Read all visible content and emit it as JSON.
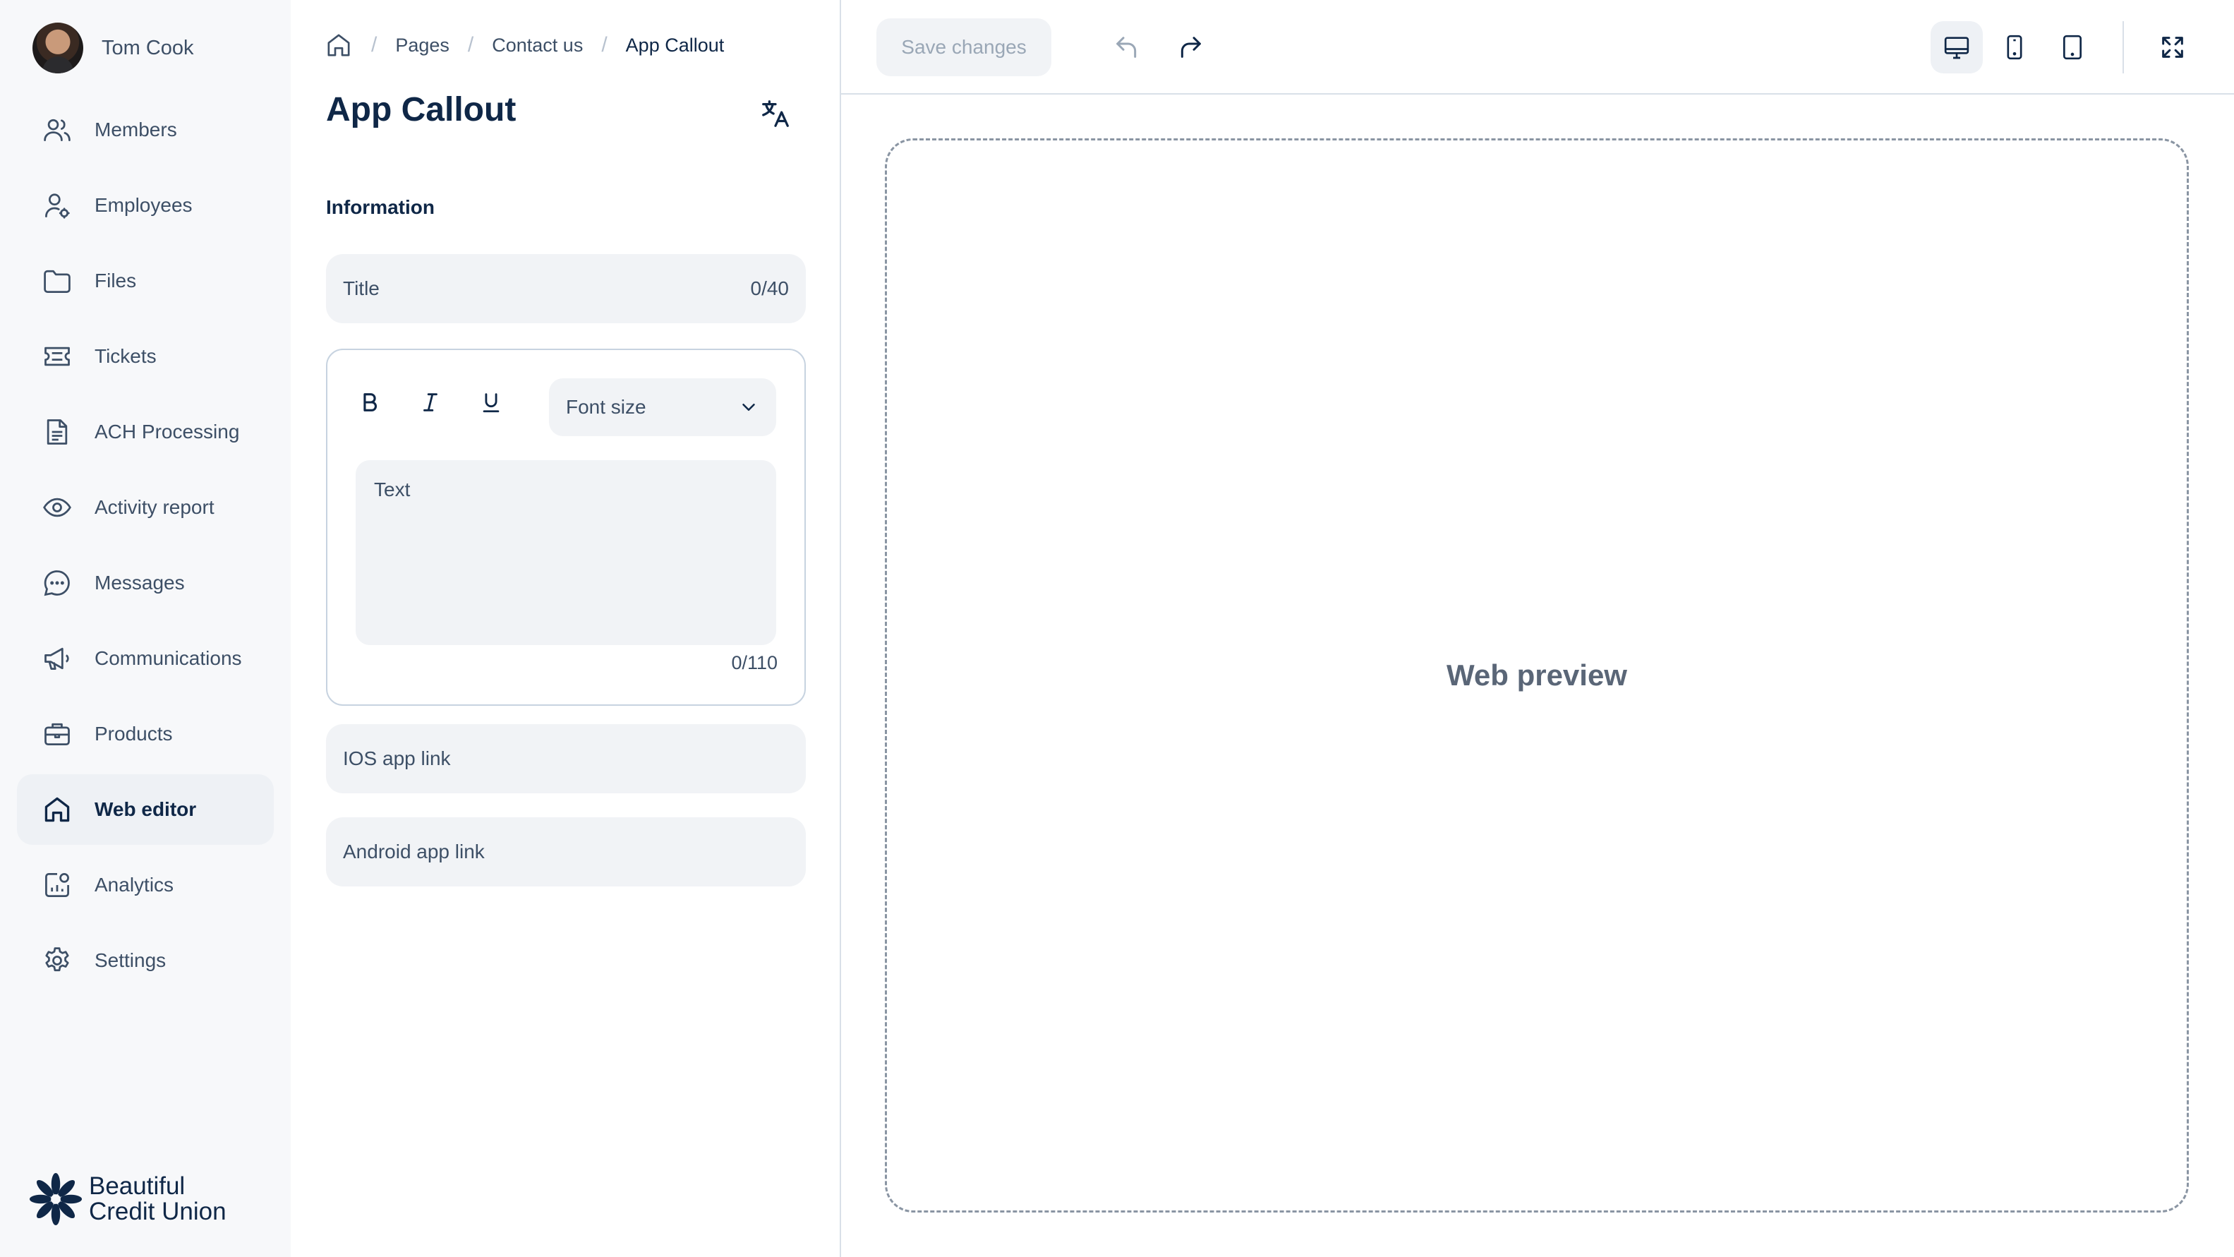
{
  "user": {
    "name": "Tom Cook"
  },
  "sidebar": {
    "items": [
      {
        "label": "Members",
        "icon": "users-icon"
      },
      {
        "label": "Employees",
        "icon": "user-icon"
      },
      {
        "label": "Files",
        "icon": "folder-icon"
      },
      {
        "label": "Tickets",
        "icon": "ticket-icon"
      },
      {
        "label": "ACH Processing",
        "icon": "document-icon"
      },
      {
        "label": "Activity report",
        "icon": "eye-icon"
      },
      {
        "label": "Messages",
        "icon": "chat-icon"
      },
      {
        "label": "Communications",
        "icon": "megaphone-icon"
      },
      {
        "label": "Products",
        "icon": "briefcase-icon"
      },
      {
        "label": "Web editor",
        "icon": "home-icon",
        "active": true
      },
      {
        "label": "Analytics",
        "icon": "chart-icon"
      },
      {
        "label": "Settings",
        "icon": "gear-icon"
      }
    ]
  },
  "brand": {
    "line1": "Beautiful",
    "line2": "Credit Union",
    "color": "#0f2747"
  },
  "breadcrumb": {
    "items": [
      "Pages",
      "Contact us",
      "App Callout"
    ],
    "separator": "/"
  },
  "page": {
    "title": "App Callout",
    "section_label": "Information"
  },
  "form": {
    "title_placeholder": "Title",
    "title_counter": "0/40",
    "editor": {
      "font_size_label": "Font size",
      "text_placeholder": "Text",
      "counter": "0/110"
    },
    "ios_placeholder": "IOS app link",
    "android_placeholder": "Android app link"
  },
  "toolbar": {
    "save_label": "Save changes"
  },
  "preview": {
    "label": "Web preview"
  },
  "colors": {
    "accent": "#0f2747",
    "muted_text": "#3d4f66",
    "field_bg": "#f1f3f6",
    "sidebar_bg": "#f7f8fa"
  }
}
